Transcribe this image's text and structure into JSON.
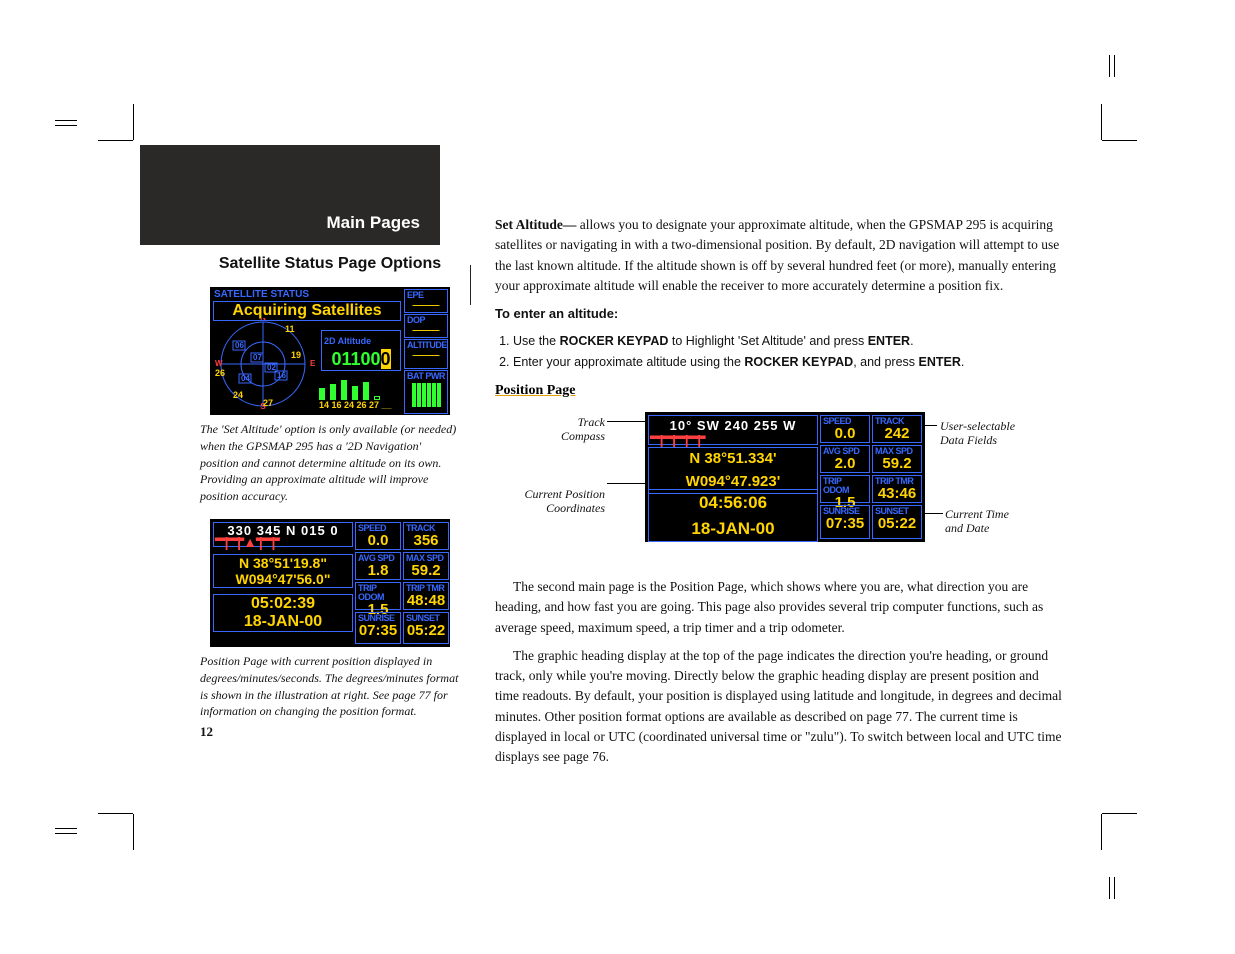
{
  "header": {
    "title": "Main Pages"
  },
  "left": {
    "subtitle": "Satellite Status Page Options",
    "caption1": "The 'Set Altitude' option is only available (or needed) when the GPSMAP 295 has a '2D Navigation' position and cannot determine altitude on its own. Providing an approximate altitude will improve position accuracy.",
    "caption2": "Position Page with current position displayed in degrees/minutes/seconds. The degrees/minutes format is shown in the illustration at right. See page 77 for information on changing the position format.",
    "pagenum": "12"
  },
  "right": {
    "setalt_label": "Set Altitude—",
    "setalt_body": " allows you to designate your approximate altitude, when the GPSMAP 295 is acquiring satellites or navigating in with a two-dimensional position. By default, 2D navigation will attempt to use the last known altitude. If the altitude shown is off by several hundred feet (or more), manually entering your approximate altitude will enable the receiver to more accurately determine a position fix.",
    "enter_alt_head": "To enter an altitude:",
    "step1a": "Use the ",
    "step1b": "ROCKER KEYPAD",
    "step1c": " to Highlight 'Set Altitude' and press ",
    "step1d": "ENTER",
    "step1e": ".",
    "step2a": "Enter your approximate altitude using the ",
    "step2b": "ROCKER KEYPAD",
    "step2c": ", and press ",
    "step2d": "ENTER",
    "step2e": ".",
    "pos_head": "Position Page",
    "para2": "The second main page is the Position Page, which shows where you are, what direction you are heading, and how fast you are going. This page also provides several trip computer functions, such as average speed, maximum speed, a trip timer and a trip odometer.",
    "para3": "The graphic heading display at the top of the page indicates the direction you're heading, or ground track, only while you're moving. Directly below the graphic heading display are present position and time readouts. By default, your position is displayed using latitude and longitude, in degrees and decimal minutes. Other position format options are available as described on page 77. The current time is displayed in local or UTC (coordinated universal time or \"zulu\"). To switch between local and UTC time displays see page 76."
  },
  "callouts": {
    "track": "Track\nCompass",
    "coords": "Current Position\nCoordinates",
    "fields": "User-selectable\nData Fields",
    "time": "Current Time\nand Date"
  },
  "sat_screen": {
    "title": "SATELLITE STATUS",
    "status": "Acquiring Satellites",
    "alt_label": "2D Altitude",
    "alt_value": "01100",
    "epe": "EPE",
    "dop": "DOP",
    "altitude": "ALTITUDE",
    "batpwr": "BAT PWR",
    "barids": "14 16 24 26 27 __",
    "sats": [
      "06",
      "07",
      "02",
      "04",
      "16",
      "11",
      "19",
      "11"
    ],
    "dirs": {
      "n": "N",
      "s": "S",
      "e": "E",
      "w": "W"
    },
    "ring1": "26",
    "ring2": "24",
    "ring3": "27"
  },
  "pos_small": {
    "compass": "330 345   N   015  0",
    "lat": "N  38°51'19.8\"",
    "lon": "W094°47'56.0\"",
    "time": "05:02:39",
    "date": "18-JAN-00",
    "speed_l": "SPEED",
    "speed_v": "0.0",
    "track_l": "TRACK",
    "track_v": "356",
    "avg_l": "AVG SPD",
    "avg_v": "1.8",
    "max_l": "MAX SPD",
    "max_v": "59.2",
    "odo_l": "TRIP ODOM",
    "odo_v": "1.5",
    "tmr_l": "TRIP TMR",
    "tmr_v": "48:48",
    "sr_l": "SUNRISE",
    "sr_v": "07:35",
    "ss_l": "SUNSET",
    "ss_v": "05:22"
  },
  "pos_large": {
    "compass": "10° SW  240 255    W",
    "lat": "N  38°51.334'",
    "lon": "W094°47.923'",
    "time": "04:56:06",
    "date": "18-JAN-00",
    "speed_l": "SPEED",
    "speed_v": "0.0",
    "track_l": "TRACK",
    "track_v": "242",
    "avg_l": "AVG SPD",
    "avg_v": "2.0",
    "max_l": "MAX SPD",
    "max_v": "59.2",
    "odo_l": "TRIP ODOM",
    "odo_v": "1.5",
    "tmr_l": "TRIP TMR",
    "tmr_v": "43:46",
    "sr_l": "SUNRISE",
    "sr_v": "07:35",
    "ss_l": "SUNSET",
    "ss_v": "05:22"
  }
}
